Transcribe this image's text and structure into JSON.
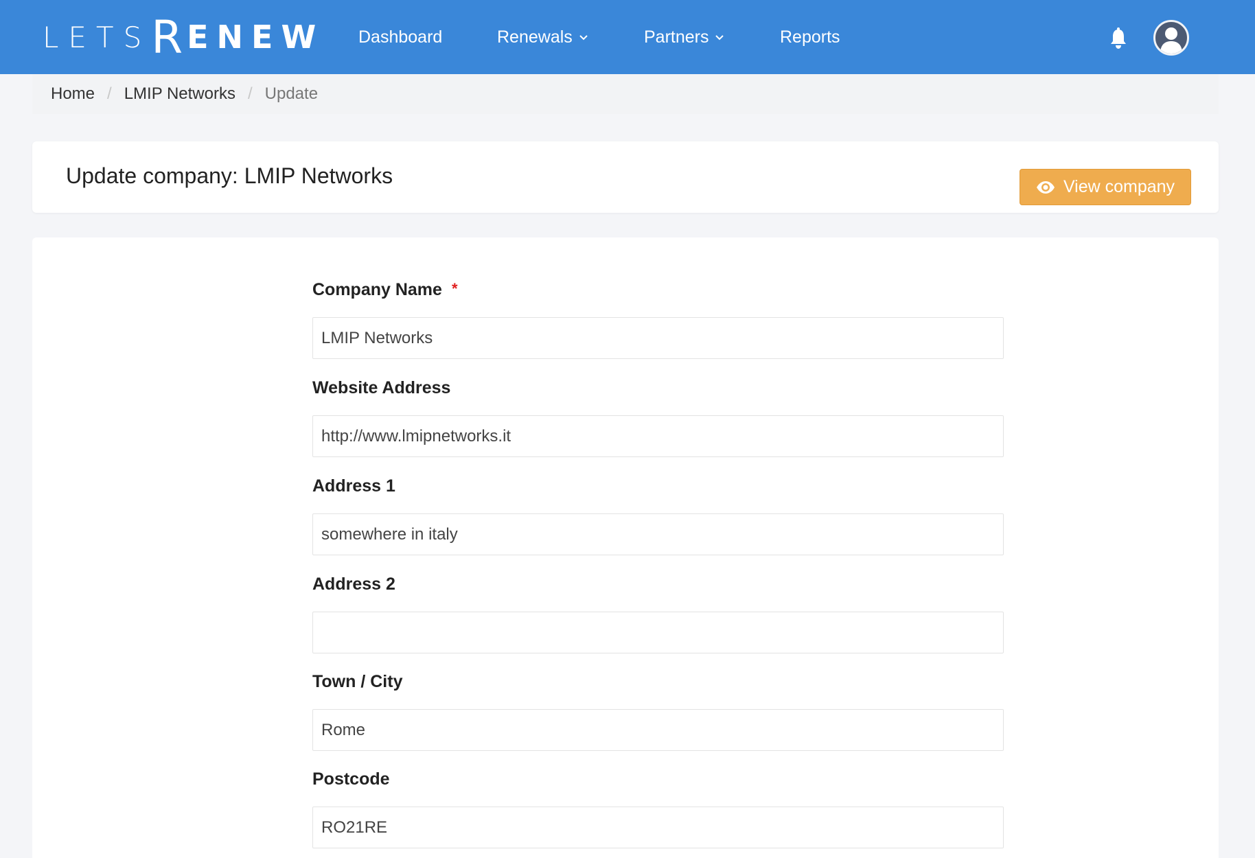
{
  "brand": {
    "lets": "LETS",
    "r": "R",
    "enew": "ENEW"
  },
  "nav": {
    "items": [
      {
        "label": "Dashboard",
        "dropdown": false
      },
      {
        "label": "Renewals",
        "dropdown": true
      },
      {
        "label": "Partners",
        "dropdown": true
      },
      {
        "label": "Reports",
        "dropdown": false
      }
    ],
    "icons": [
      "bell-icon",
      "user-avatar-icon"
    ]
  },
  "breadcrumb": {
    "items": [
      "Home",
      "LMIP Networks",
      "Update"
    ],
    "separator": "/"
  },
  "header": {
    "title": "Update company: LMIP Networks",
    "view_button": "View company",
    "view_icon": "eye-icon"
  },
  "form": {
    "fields": [
      {
        "label": "Company Name",
        "required": true,
        "required_mark": "*",
        "value": "LMIP Networks"
      },
      {
        "label": "Website Address",
        "required": false,
        "value": "http://www.lmipnetworks.it"
      },
      {
        "label": "Address 1",
        "required": false,
        "value": "somewhere in italy"
      },
      {
        "label": "Address 2",
        "required": false,
        "value": ""
      },
      {
        "label": "Town / City",
        "required": false,
        "value": "Rome"
      },
      {
        "label": "Postcode",
        "required": false,
        "value": "RO21RE"
      }
    ]
  },
  "colors": {
    "navbar": "#3a87d9",
    "primary_button": "#efac4e",
    "required": "#e02020",
    "background": "#f4f5f8"
  }
}
